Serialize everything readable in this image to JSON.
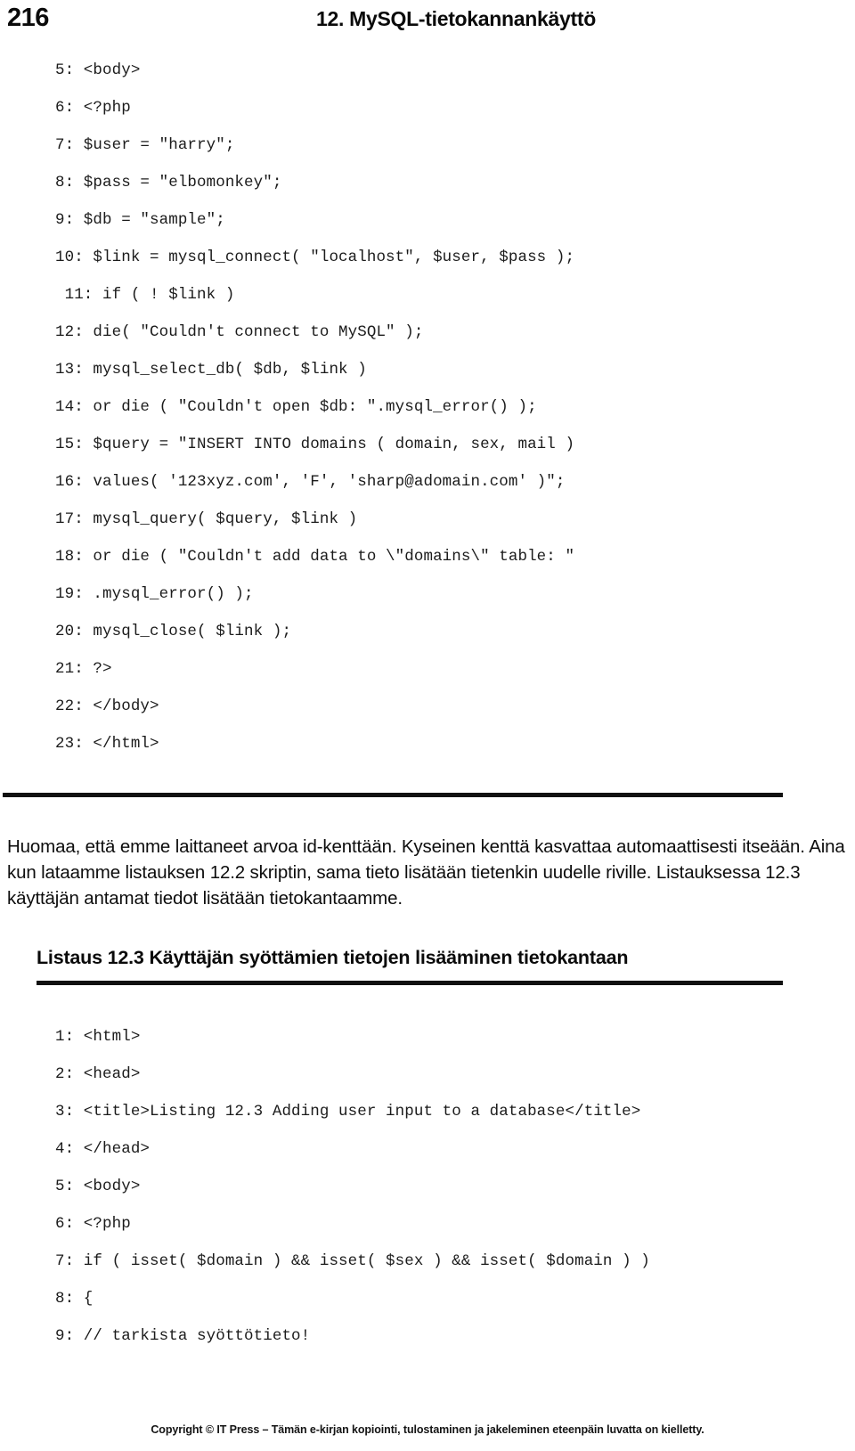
{
  "page": {
    "folio": "216",
    "chapter_title": "12. MySQL-tietokannankäyttö"
  },
  "listing_1": {
    "lines": [
      "5: <body>",
      "6: <?php",
      "7: $user = \"harry\";",
      "8: $pass = \"elbomonkey\";",
      "9: $db = \"sample\";",
      "10: $link = mysql_connect( \"localhost\", $user, $pass );",
      " 11: if ( ! $link )",
      "12: die( \"Couldn't connect to MySQL\" );",
      "13: mysql_select_db( $db, $link )",
      "14: or die ( \"Couldn't open $db: \".mysql_error() );",
      "15: $query = \"INSERT INTO domains ( domain, sex, mail )",
      "16: values( '123xyz.com', 'F', 'sharp@adomain.com' )\";",
      "17: mysql_query( $query, $link )",
      "18: or die ( \"Couldn't add data to \\\"domains\\\" table: \"",
      "19: .mysql_error() );",
      "20: mysql_close( $link );",
      "21: ?>",
      "22: </body>",
      "23: </html>"
    ]
  },
  "body_paragraph": {
    "text": "Huomaa, että emme laittaneet arvoa id-kenttään. Kyseinen kenttä kasvattaa automaattisesti itseään. Aina kun lataamme listauksen 12.2 skriptin, sama tieto lisätään tietenkin uudelle riville. Listauksessa 12.3 käyttäjän antamat tiedot lisätään tietokantaamme."
  },
  "listing_2": {
    "heading": "Listaus 12.3 Käyttäjän syöttämien tietojen lisääminen tietokantaan",
    "lines": [
      "1: <html>",
      "2: <head>",
      "3: <title>Listing 12.3 Adding user input to a database</title>",
      "4: </head>",
      "5: <body>",
      "6: <?php",
      "7: if ( isset( $domain ) && isset( $sex ) && isset( $domain ) )",
      "8: {",
      "9: // tarkista syöttötieto!"
    ]
  },
  "footer": {
    "text": "Copyright © IT Press – Tämän e-kirjan kopiointi, tulostaminen ja jakeleminen eteenpäin luvatta on kielletty."
  }
}
